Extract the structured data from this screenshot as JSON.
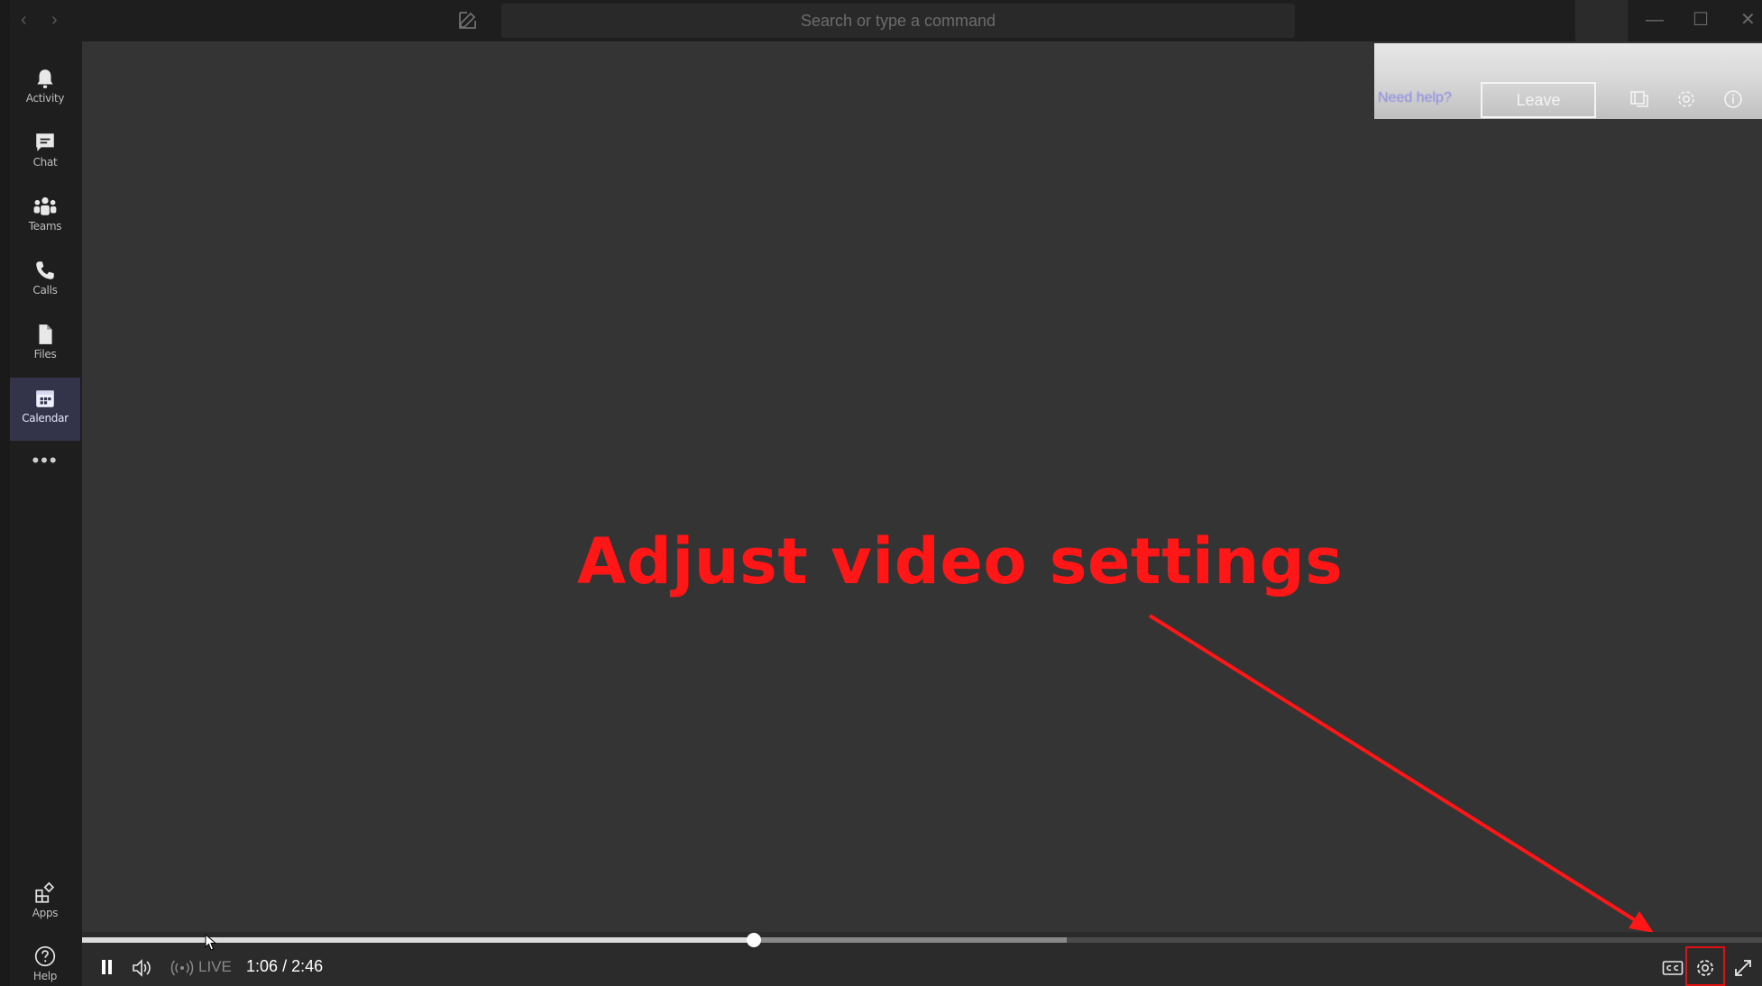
{
  "titlebar": {
    "back_glyph": "‹",
    "forward_glyph": "›",
    "search_placeholder": "Search or type a command",
    "minimize_glyph": "—",
    "maximize_glyph": "☐",
    "close_glyph": "✕"
  },
  "rail": {
    "items": [
      {
        "label": "Activity",
        "icon": "bell-icon"
      },
      {
        "label": "Chat",
        "icon": "chat-icon"
      },
      {
        "label": "Teams",
        "icon": "teams-icon"
      },
      {
        "label": "Calls",
        "icon": "phone-icon"
      },
      {
        "label": "Files",
        "icon": "file-icon"
      },
      {
        "label": "Calendar",
        "icon": "calendar-icon",
        "active": true
      }
    ],
    "more_glyph": "•••",
    "bottom": [
      {
        "label": "Apps",
        "icon": "apps-icon"
      },
      {
        "label": "Help",
        "icon": "help-icon"
      }
    ]
  },
  "overlay": {
    "help_link": "Need help?",
    "leave_label": "Leave"
  },
  "annotation": {
    "text": "Adjust video settings",
    "color": "#ff1616"
  },
  "player": {
    "live_label": "LIVE",
    "current_time": "1:06",
    "separator": "/",
    "total_time": "2:46",
    "progress": 0.4,
    "buffered": 0.586
  },
  "colors": {
    "rail_active": "#33344a",
    "stage_bg": "#343434",
    "annotation_red": "#ff1616",
    "highlight_red": "#e01010"
  }
}
